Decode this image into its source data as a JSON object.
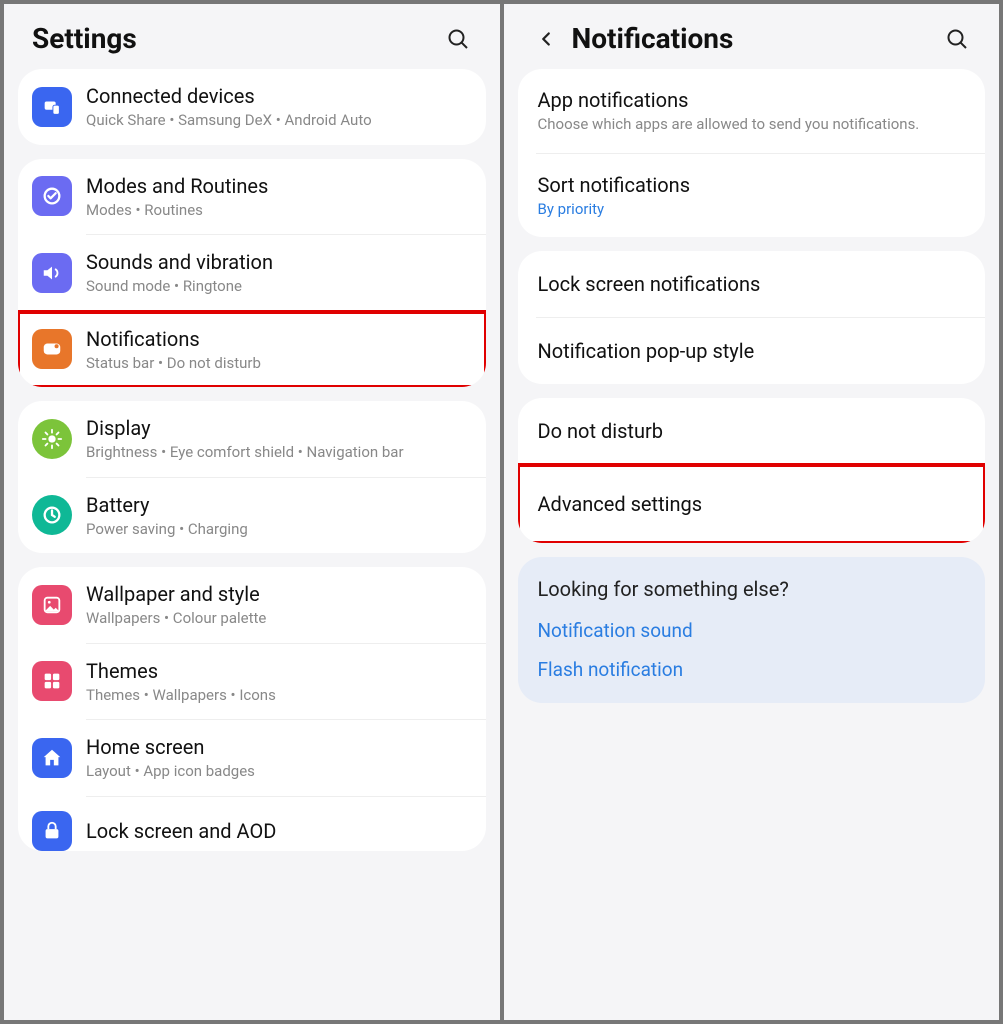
{
  "left": {
    "title": "Settings",
    "items": [
      {
        "title": "Connected devices",
        "sub": "Quick Share  •  Samsung DeX  •  Android Auto",
        "icon": "devices-icon",
        "bg": "#3a66f0"
      },
      {
        "title": "Modes and Routines",
        "sub": "Modes  •  Routines",
        "icon": "routines-icon",
        "bg": "#6b6bf2"
      },
      {
        "title": "Sounds and vibration",
        "sub": "Sound mode  •  Ringtone",
        "icon": "sound-icon",
        "bg": "#6b6bf2"
      },
      {
        "title": "Notifications",
        "sub": "Status bar  •  Do not disturb",
        "icon": "notifications-icon",
        "bg": "#e8762a",
        "highlight": true
      },
      {
        "title": "Display",
        "sub": "Brightness  •  Eye comfort shield  •  Navigation bar",
        "icon": "display-icon",
        "bg": "#7cc43a"
      },
      {
        "title": "Battery",
        "sub": "Power saving  •  Charging",
        "icon": "battery-icon",
        "bg": "#0fb896"
      },
      {
        "title": "Wallpaper and style",
        "sub": "Wallpapers  •  Colour palette",
        "icon": "wallpaper-icon",
        "bg": "#e84a6f"
      },
      {
        "title": "Themes",
        "sub": "Themes  •  Wallpapers  •  Icons",
        "icon": "themes-icon",
        "bg": "#e84a6f"
      },
      {
        "title": "Home screen",
        "sub": "Layout  •  App icon badges",
        "icon": "home-icon",
        "bg": "#3a66f0"
      },
      {
        "title": "Lock screen and AOD",
        "sub": "",
        "icon": "lock-icon",
        "bg": "#3a66f0"
      }
    ]
  },
  "right": {
    "title": "Notifications",
    "group1": {
      "app_notifications": {
        "title": "App notifications",
        "sub": "Choose which apps are allowed to send you notifications."
      },
      "sort": {
        "title": "Sort notifications",
        "sub": "By priority"
      }
    },
    "group2": {
      "lock": {
        "title": "Lock screen notifications"
      },
      "popup": {
        "title": "Notification pop-up style"
      }
    },
    "group3": {
      "dnd": {
        "title": "Do not disturb"
      },
      "advanced": {
        "title": "Advanced settings"
      }
    },
    "suggest": {
      "title": "Looking for something else?",
      "link1": "Notification sound",
      "link2": "Flash notification"
    }
  }
}
